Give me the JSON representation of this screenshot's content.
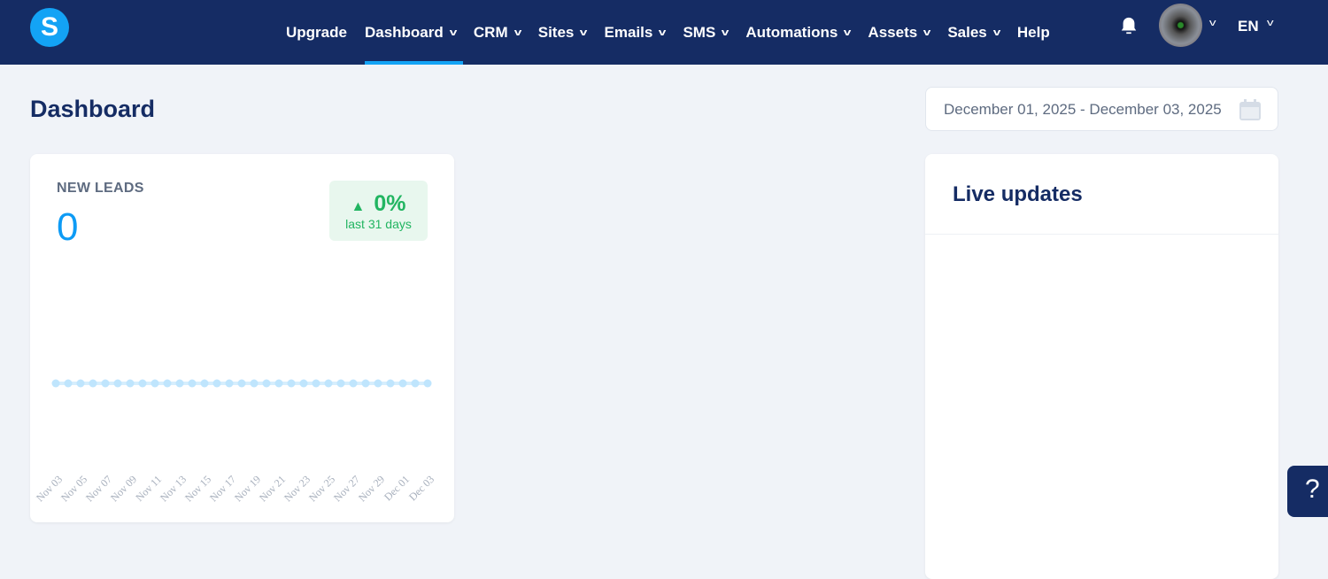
{
  "nav": {
    "logo": "S",
    "items": [
      {
        "label": "Upgrade",
        "chevron": false
      },
      {
        "label": "Dashboard",
        "chevron": true,
        "active": true
      },
      {
        "label": "CRM",
        "chevron": true
      },
      {
        "label": "Sites",
        "chevron": true
      },
      {
        "label": "Emails",
        "chevron": true
      },
      {
        "label": "SMS",
        "chevron": true
      },
      {
        "label": "Automations",
        "chevron": true
      },
      {
        "label": "Assets",
        "chevron": true
      },
      {
        "label": "Sales",
        "chevron": true
      },
      {
        "label": "Help",
        "chevron": false
      }
    ],
    "language": "EN"
  },
  "page": {
    "title": "Dashboard",
    "date_range": "December 01, 2025 - December 03, 2025"
  },
  "leads": {
    "title": "NEW LEADS",
    "value": "0",
    "change": "0%",
    "period": "last 31 days"
  },
  "live": {
    "title": "Live updates"
  },
  "help_button": "?",
  "colors": {
    "nav": "#152c64",
    "accent": "#13a3f5",
    "positive": "#22b561"
  },
  "chart_data": {
    "type": "line",
    "title": "New leads",
    "ylim": [
      0,
      1
    ],
    "x": [
      "Nov 03",
      "Nov 04",
      "Nov 05",
      "Nov 06",
      "Nov 07",
      "Nov 08",
      "Nov 09",
      "Nov 10",
      "Nov 11",
      "Nov 12",
      "Nov 13",
      "Nov 14",
      "Nov 15",
      "Nov 16",
      "Nov 17",
      "Nov 18",
      "Nov 19",
      "Nov 20",
      "Nov 21",
      "Nov 22",
      "Nov 23",
      "Nov 24",
      "Nov 25",
      "Nov 26",
      "Nov 27",
      "Nov 28",
      "Nov 29",
      "Nov 30",
      "Dec 01",
      "Dec 02",
      "Dec 03"
    ],
    "tick_labels": [
      "Nov 03",
      "Nov 05",
      "Nov 07",
      "Nov 09",
      "Nov 11",
      "Nov 13",
      "Nov 15",
      "Nov 17",
      "Nov 19",
      "Nov 21",
      "Nov 23",
      "Nov 25",
      "Nov 27",
      "Nov 29",
      "Dec 01",
      "Dec 03"
    ],
    "values": [
      0,
      0,
      0,
      0,
      0,
      0,
      0,
      0,
      0,
      0,
      0,
      0,
      0,
      0,
      0,
      0,
      0,
      0,
      0,
      0,
      0,
      0,
      0,
      0,
      0,
      0,
      0,
      0,
      0,
      0,
      0
    ]
  }
}
